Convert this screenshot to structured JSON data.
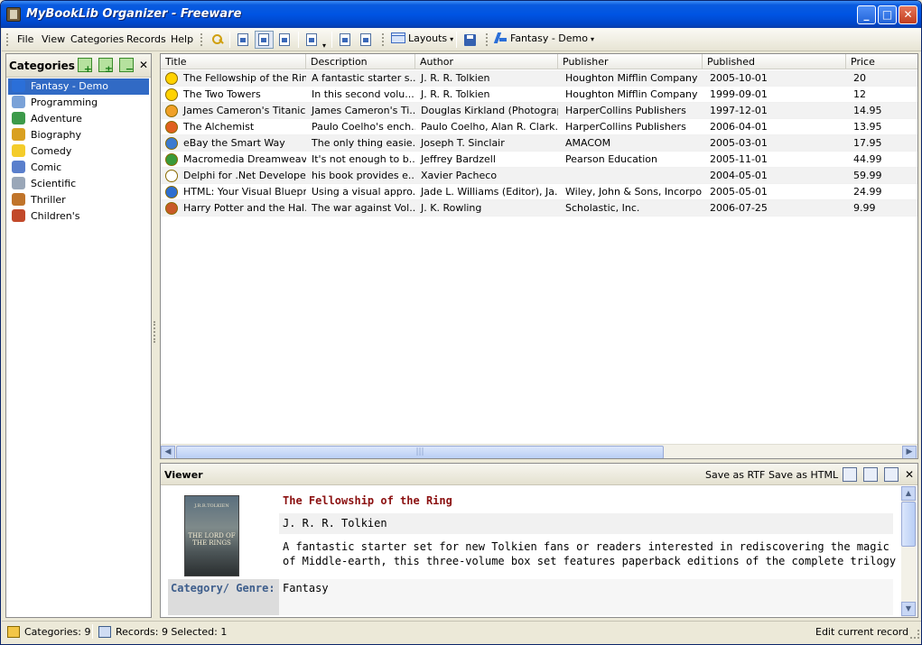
{
  "window": {
    "title": "MyBookLib Organizer - Freeware"
  },
  "menu": {
    "items": [
      "File",
      "View",
      "Categories",
      "Records",
      "Help"
    ]
  },
  "toolbar": {
    "layouts_label": "Layouts",
    "current_category_label": "Fantasy - Demo"
  },
  "categories_panel": {
    "title": "Categories",
    "items": [
      {
        "label": "Fantasy - Demo",
        "icon": "fantasy-icon",
        "color": "#2b6fd8",
        "selected": true
      },
      {
        "label": "Programming",
        "icon": "programming-icon",
        "color": "#7aa2d8",
        "selected": false
      },
      {
        "label": "Adventure",
        "icon": "globe-icon",
        "color": "#3c9a4a",
        "selected": false
      },
      {
        "label": "Biography",
        "icon": "person-icon",
        "color": "#d9a020",
        "selected": false
      },
      {
        "label": "Comedy",
        "icon": "smiley-icon",
        "color": "#f4cc2a",
        "selected": false
      },
      {
        "label": "Comic",
        "icon": "comic-icon",
        "color": "#5a7fcc",
        "selected": false
      },
      {
        "label": "Scientific",
        "icon": "scientific-icon",
        "color": "#9aa7b8",
        "selected": false
      },
      {
        "label": "Thriller",
        "icon": "thriller-icon",
        "color": "#c0742a",
        "selected": false
      },
      {
        "label": "Children's",
        "icon": "books-icon",
        "color": "#c2492a",
        "selected": false
      }
    ]
  },
  "grid": {
    "columns": [
      "Title",
      "Description",
      "Author",
      "Publisher",
      "Published",
      "Price"
    ],
    "rows": [
      {
        "icon": "ring-icon",
        "color": "#ffd200",
        "title": "The Fellowship of the Ring",
        "description": "A fantastic starter s...",
        "author": "J. R. R. Tolkien",
        "publisher": "Houghton Mifflin Company",
        "published": "2005-10-01",
        "price": "20"
      },
      {
        "icon": "ring-icon",
        "color": "#ffd200",
        "title": "The Two Towers",
        "description": "In this second volu...",
        "author": "J. R. R. Tolkien",
        "publisher": "Houghton Mifflin Company",
        "published": "1999-09-01",
        "price": "12"
      },
      {
        "icon": "person-icon",
        "color": "#f0a028",
        "title": "James Cameron's Titanic",
        "description": "James Cameron's Ti...",
        "author": "Douglas Kirkland (Photograp...",
        "publisher": "HarperCollins Publishers",
        "published": "1997-12-01",
        "price": "14.95"
      },
      {
        "icon": "crown-icon",
        "color": "#e06020",
        "title": "The Alchemist",
        "description": "Paulo Coelho's ench...",
        "author": "Paulo Coelho, Alan R. Clark...",
        "publisher": "HarperCollins Publishers",
        "published": "2006-04-01",
        "price": "13.95"
      },
      {
        "icon": "globe-icon",
        "color": "#3c7ad0",
        "title": "eBay the Smart Way",
        "description": "The only thing easie...",
        "author": "Joseph T. Sinclair",
        "publisher": "AMACOM",
        "published": "2005-03-01",
        "price": "17.95"
      },
      {
        "icon": "dreamweaver-icon",
        "color": "#3a9a3a",
        "title": "Macromedia Dreamweav...",
        "description": "It's not enough to b...",
        "author": "Jeffrey Bardzell",
        "publisher": "Pearson Education",
        "published": "2005-11-01",
        "price": "44.99"
      },
      {
        "icon": "document-icon",
        "color": "#ffffff",
        "title": "Delphi for .Net Develope...",
        "description": "his book provides e...",
        "author": "Xavier Pacheco",
        "publisher": "",
        "published": "2004-05-01",
        "price": "59.99"
      },
      {
        "icon": "browser-icon",
        "color": "#2f6fd0",
        "title": "HTML: Your Visual Bluepr...",
        "description": "Using a visual appro...",
        "author": "Jade L. Williams (Editor), Ja...",
        "publisher": "Wiley, John & Sons, Incorpo...",
        "published": "2005-05-01",
        "price": "24.99"
      },
      {
        "icon": "wand-icon",
        "color": "#c85a28",
        "title": "Harry Potter and the Hal...",
        "description": "The war against Vol...",
        "author": "J. K. Rowling",
        "publisher": "Scholastic, Inc.",
        "published": "2006-07-25",
        "price": "9.99"
      }
    ]
  },
  "viewer": {
    "title": "Viewer",
    "save_rtf": "Save as RTF",
    "save_html": "Save as HTML",
    "book_title": "The Fellowship of the Ring",
    "author": "J. R. R. Tolkien",
    "description": "A fantastic starter set for new Tolkien fans or readers interested in rediscovering the magic of Middle-earth, this three-volume box set features paperback editions of the complete trilogy",
    "category_label": "Category/ Genre:",
    "category_value": "Fantasy",
    "cover": {
      "author": "J.R.R.TOLKIEN",
      "title": "THE LORD OF THE RINGS"
    }
  },
  "statusbar": {
    "categories": "Categories: 9",
    "records": "Records: 9 Selected: 1",
    "mode": "Edit current record"
  }
}
